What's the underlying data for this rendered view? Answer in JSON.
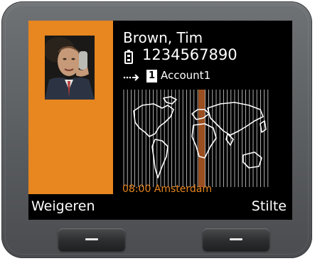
{
  "call": {
    "caller_name": "Brown, Tim",
    "phone_number": "1234567890",
    "account_index": "1",
    "account_name": "Account1"
  },
  "clock": {
    "time_city": "08:00 Amsterdam"
  },
  "softkeys": {
    "left_label": "Weigeren",
    "right_label": "Stilte"
  },
  "colors": {
    "accent": "#e8861f",
    "screen_background": "#000000",
    "text": "#ffffff",
    "device_body": "#5f6265"
  },
  "icons": {
    "phone": "mobile-phone-icon",
    "forward": "call-forward-arrow-icon",
    "map": "world-map-icon",
    "softkey": "softkey-bar-icon"
  }
}
